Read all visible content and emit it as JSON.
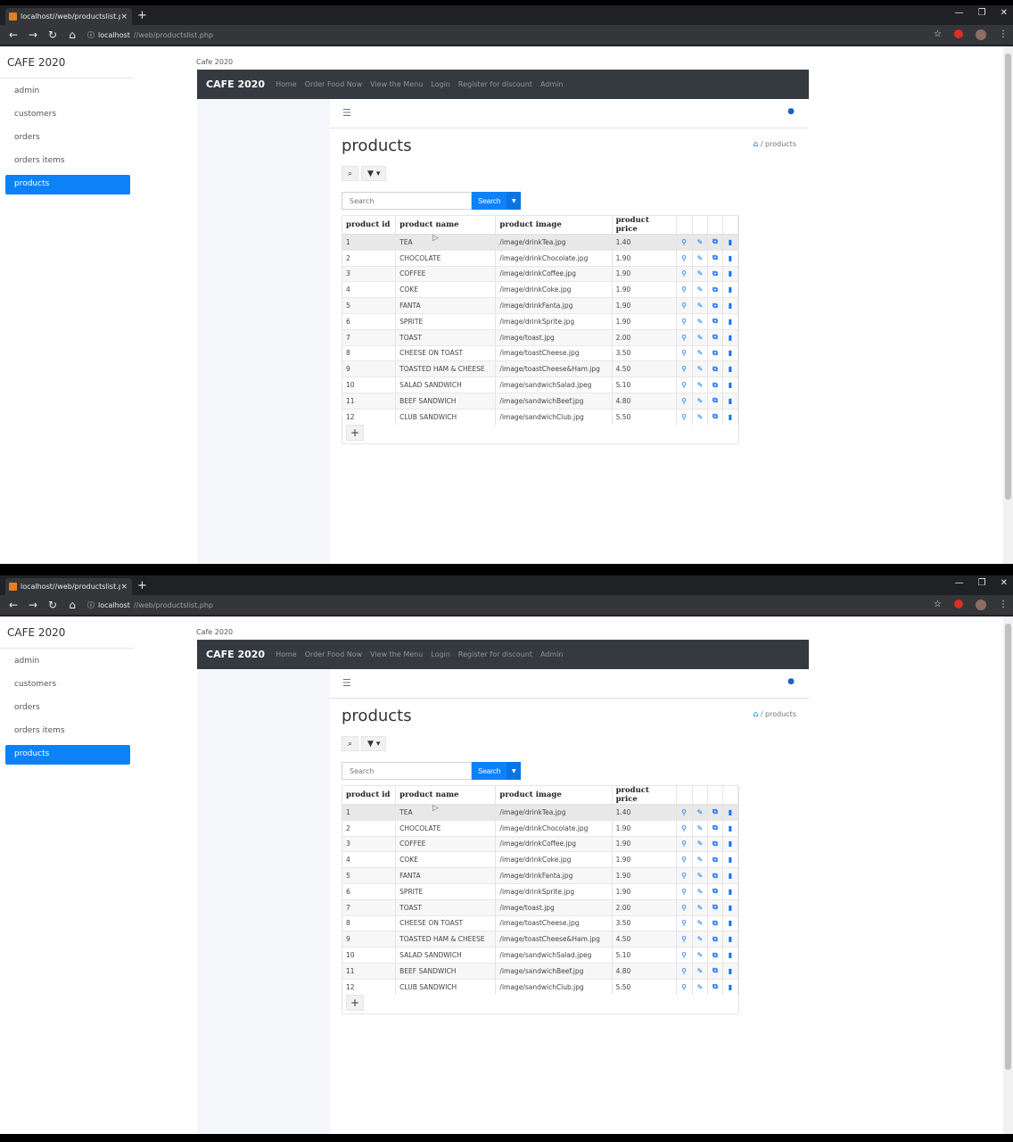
{
  "browser": {
    "tab_title": "localhost//web/productslist.php",
    "tab_close": "×",
    "new_tab": "+",
    "url_host": "localhost",
    "url_path": "//web/productslist.php"
  },
  "sidebar": {
    "brand": "CAFE 2020",
    "items": [
      {
        "label": "admin"
      },
      {
        "label": "customers"
      },
      {
        "label": "orders"
      },
      {
        "label": "orders items"
      },
      {
        "label": "products"
      }
    ]
  },
  "site_label": "Cafe 2020",
  "topnav": {
    "brand": "CAFE 2020",
    "links": [
      "Home",
      "Order Food Now",
      "View the Menu",
      "Login",
      "Register for discount",
      "Admin"
    ]
  },
  "page": {
    "title": "products",
    "breadcrumb": "/ products"
  },
  "search": {
    "placeholder": "Search",
    "button": "Search"
  },
  "table": {
    "headers": [
      "product id",
      "product name",
      "product image",
      "product price"
    ],
    "rows": [
      [
        "1",
        "TEA",
        "/image/drinkTea.jpg",
        "1.40"
      ],
      [
        "2",
        "CHOCOLATE",
        "/image/drinkChocolate.jpg",
        "1.90"
      ],
      [
        "3",
        "COFFEE",
        "/image/drinkCoffee.jpg",
        "1.90"
      ],
      [
        "4",
        "COKE",
        "/image/drinkCoke.jpg",
        "1.90"
      ],
      [
        "5",
        "FANTA",
        "/image/drinkFanta.jpg",
        "1.90"
      ],
      [
        "6",
        "SPRITE",
        "/image/drinkSprite.jpg",
        "1.90"
      ],
      [
        "7",
        "TOAST",
        "/image/toast.jpg",
        "2.00"
      ],
      [
        "8",
        "CHEESE ON TOAST",
        "/image/toastCheese.jpg",
        "3.50"
      ],
      [
        "9",
        "TOASTED HAM & CHEESE",
        "/image/toastCheese&Ham.jpg",
        "4.50"
      ],
      [
        "10",
        "SALAD SANDWICH",
        "/image/sandwichSalad.jpeg",
        "5.10"
      ],
      [
        "11",
        "BEEF SANDWICH",
        "/image/sandwichBeef.jpg",
        "4.80"
      ],
      [
        "12",
        "CLUB SANDWICH",
        "/image/sandwichClub.jpg",
        "5.50"
      ]
    ]
  },
  "icons": [
    "search-icon",
    "filter-icon",
    "view-icon",
    "edit-icon",
    "copy-icon",
    "delete-icon",
    "menu-icon",
    "user-icon",
    "home-icon",
    "add-icon"
  ]
}
